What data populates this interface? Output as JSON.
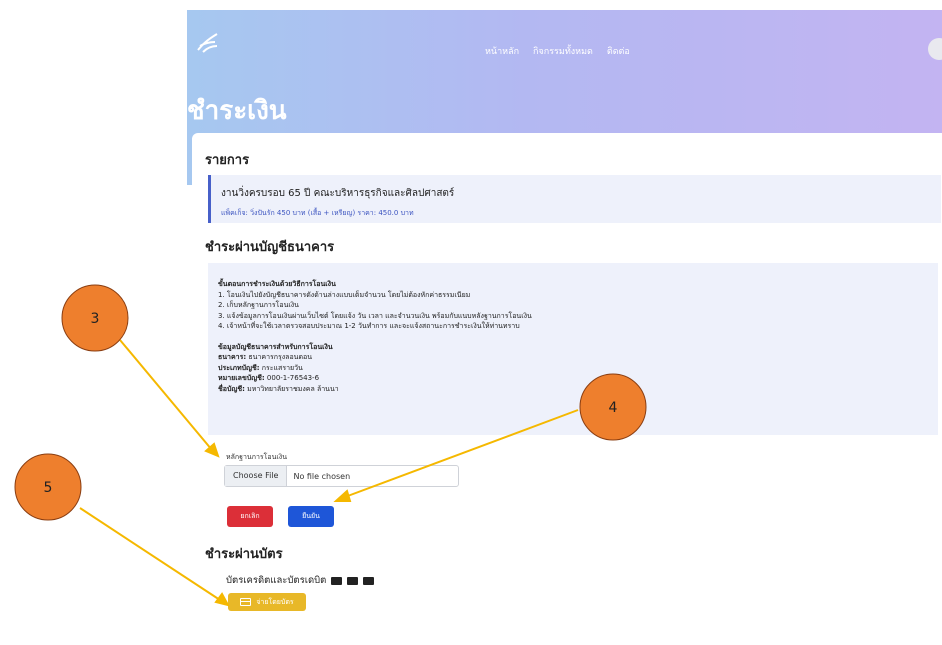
{
  "nav": {
    "items": [
      "หน้าหลัก",
      "กิจกรรมทั้งหมด",
      "ติดต่อ"
    ]
  },
  "page": {
    "title": "ชำระเงิน"
  },
  "order": {
    "section_title": "รายการ",
    "event_name": "งานวิ่งครบรอบ 65 ปี คณะบริหารธุรกิจและศิลปศาสตร์",
    "package_line": "แพ็คเก็จ: วิ่งปันรัก 450 บาท (เสื้อ + เหรียญ) ราคา: 450.0 บาท"
  },
  "bank": {
    "section_title": "ชำระผ่านบัญชีธนาคาร",
    "steps_title": "ขั้นตอนการชำระเงินด้วยวิธีการโอนเงิน",
    "steps": [
      "1.  โอนเงินไปยังบัญชีธนาคารดังด้านล่างแบบเต็มจำนวน โดยไม่ต้องหักค่าธรรมเนียม",
      "2.  เก็บหลักฐานการโอนเงิน",
      "3.  แจ้งข้อมูลการโอนเงินผ่านเว็บไซต์ โดยแจ้ง วัน เวลา และจำนวนเงิน พร้อมกับแนบหลังฐานการโอนเงิน",
      "4.  เจ้าหน้าที่จะใช้เวลาตรวจสอบประมาณ 1-2 วันทำการ และจะแจ้งสถานะการชำระเงินให้ท่านทราบ"
    ],
    "account_title": "ข้อมูลบัญชีธนาคารสำหรับการโอนเงิน",
    "bank_label": "ธนาคาร:",
    "bank_value": "ธนาคารกรุงลอนดอน",
    "type_label": "ประเภทบัญชี:",
    "type_value": "กระแสรายวัน",
    "number_label": "หมายเลขบัญชี:",
    "number_value": "000-1-76543-6",
    "name_label": "ชื่อบัญชี:",
    "name_value": "มหาวิทยาลัยราชมงคล ล้านนา"
  },
  "upload": {
    "label": "หลักฐานการโอนเงิน",
    "button_label": "Choose File",
    "status": "No file chosen"
  },
  "actions": {
    "cancel_label": "ยกเลิก",
    "confirm_label": "ยืนยัน"
  },
  "card_payment": {
    "section_title": "ชำระผ่านบัตร",
    "subtitle": "บัตรเครดิตและบัตรเดบิต",
    "pay_label": "จ่ายโดยบัตร"
  },
  "annotations": {
    "badges": [
      "3",
      "4",
      "5"
    ],
    "badge_color": "#ee7f2d",
    "arrow_color": "#f5b800"
  },
  "colors": {
    "cancel": "#dc2f38",
    "confirm": "#1e56d8",
    "pay": "#e8b828",
    "accent": "#4760c9"
  }
}
